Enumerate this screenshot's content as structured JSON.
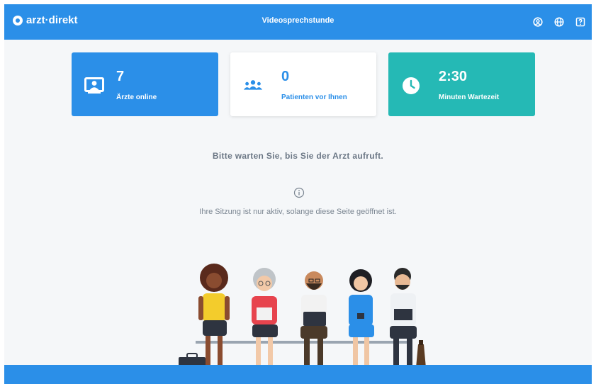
{
  "header": {
    "logo_text": "arzt·direkt",
    "title": "Videosprechstunde",
    "icons": [
      "user-icon",
      "globe-icon",
      "help-icon"
    ]
  },
  "stats": [
    {
      "value": "7",
      "label": "Ärzte online",
      "icon": "doctor-screen-icon"
    },
    {
      "value": "0",
      "label": "Patienten vor Ihnen",
      "icon": "group-icon"
    },
    {
      "value": "2:30",
      "label": "Minuten Wartezeit",
      "icon": "clock-icon"
    }
  ],
  "messages": {
    "wait": "Bitte warten Sie, bis Sie der Arzt aufruft.",
    "info": "Ihre Sitzung ist nur aktiv, solange diese Seite geöffnet ist."
  },
  "colors": {
    "primary": "#2b8fe8",
    "teal": "#25b9b5"
  }
}
